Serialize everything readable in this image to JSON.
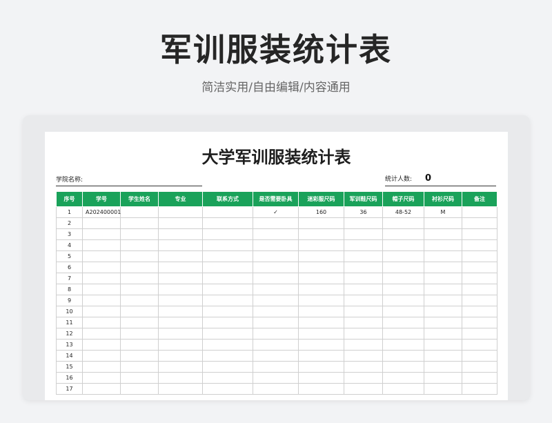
{
  "hero": {
    "title": "军训服装统计表",
    "subtitle": "简洁实用/自由编辑/内容通用"
  },
  "sheet": {
    "title": "大学军训服装统计表",
    "college_label": "学院名称:",
    "count_label": "统计人数:",
    "count_value": "0"
  },
  "table": {
    "headers": [
      "序号",
      "学号",
      "学生姓名",
      "专业",
      "联系方式",
      "是否需要卧具",
      "迷彩服尺码",
      "军训鞋尺码",
      "帽子尺码",
      "衬衫尺码",
      "备注"
    ],
    "rows": [
      [
        "1",
        "A202400001",
        "",
        "",
        "",
        "✓",
        "160",
        "36",
        "48-52",
        "M",
        ""
      ],
      [
        "2",
        "",
        "",
        "",
        "",
        "",
        "",
        "",
        "",
        "",
        ""
      ],
      [
        "3",
        "",
        "",
        "",
        "",
        "",
        "",
        "",
        "",
        "",
        ""
      ],
      [
        "4",
        "",
        "",
        "",
        "",
        "",
        "",
        "",
        "",
        "",
        ""
      ],
      [
        "5",
        "",
        "",
        "",
        "",
        "",
        "",
        "",
        "",
        "",
        ""
      ],
      [
        "6",
        "",
        "",
        "",
        "",
        "",
        "",
        "",
        "",
        "",
        ""
      ],
      [
        "7",
        "",
        "",
        "",
        "",
        "",
        "",
        "",
        "",
        "",
        ""
      ],
      [
        "8",
        "",
        "",
        "",
        "",
        "",
        "",
        "",
        "",
        "",
        ""
      ],
      [
        "9",
        "",
        "",
        "",
        "",
        "",
        "",
        "",
        "",
        "",
        ""
      ],
      [
        "10",
        "",
        "",
        "",
        "",
        "",
        "",
        "",
        "",
        "",
        ""
      ],
      [
        "11",
        "",
        "",
        "",
        "",
        "",
        "",
        "",
        "",
        "",
        ""
      ],
      [
        "12",
        "",
        "",
        "",
        "",
        "",
        "",
        "",
        "",
        "",
        ""
      ],
      [
        "13",
        "",
        "",
        "",
        "",
        "",
        "",
        "",
        "",
        "",
        ""
      ],
      [
        "14",
        "",
        "",
        "",
        "",
        "",
        "",
        "",
        "",
        "",
        ""
      ],
      [
        "15",
        "",
        "",
        "",
        "",
        "",
        "",
        "",
        "",
        "",
        ""
      ],
      [
        "16",
        "",
        "",
        "",
        "",
        "",
        "",
        "",
        "",
        "",
        ""
      ],
      [
        "17",
        "",
        "",
        "",
        "",
        "",
        "",
        "",
        "",
        "",
        ""
      ]
    ]
  },
  "colors": {
    "header_green": "#1aa25a",
    "page_bg": "#f2f3f5"
  }
}
